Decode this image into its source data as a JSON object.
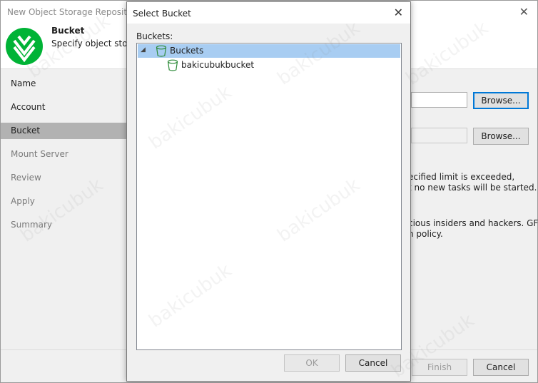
{
  "wizard": {
    "title": "New Object Storage Repository",
    "header_title": "Bucket",
    "header_subtitle": "Specify object storag",
    "nav": [
      {
        "label": "Name",
        "state": "disabled"
      },
      {
        "label": "Account",
        "state": "normal"
      },
      {
        "label": "Bucket",
        "state": "active"
      },
      {
        "label": "Mount Server",
        "state": "disabled"
      },
      {
        "label": "Review",
        "state": "disabled"
      },
      {
        "label": "Apply",
        "state": "disabled"
      },
      {
        "label": "Summary",
        "state": "disabled"
      }
    ],
    "browse_label_1": "Browse...",
    "browse_label_2": "Browse...",
    "text_line_1": "ecified limit is exceeded,",
    "text_line_2": "t no new tasks will be started.",
    "text_line_3": "cious insiders and hackers. GFS",
    "text_line_4": "n policy.",
    "finish_label": "Finish",
    "cancel_label": "Cancel"
  },
  "dialog": {
    "title": "Select Bucket",
    "buckets_label": "Buckets:",
    "tree": [
      {
        "label": "Buckets",
        "selected": true
      },
      {
        "label": "bakicubukbucket",
        "selected": false
      }
    ],
    "ok_label": "OK",
    "cancel_label": "Cancel"
  },
  "watermark": "bakicubuk",
  "colors": {
    "accent": "#0078d7",
    "selection": "#a8cdf2",
    "logo": "#00b336",
    "bucket_icon": "#2e8b3a"
  }
}
